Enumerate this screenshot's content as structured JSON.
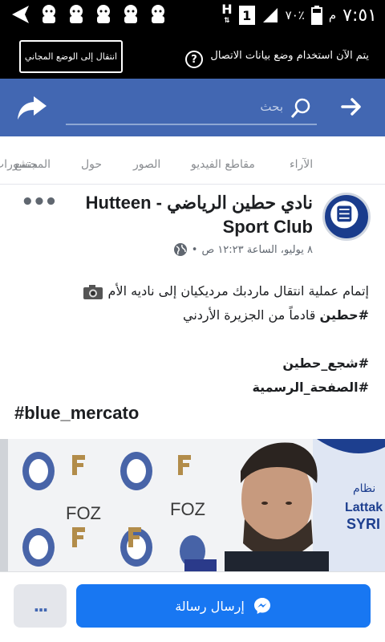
{
  "status_bar": {
    "time": "٧:٥١",
    "am_pm": "م",
    "battery_percent": "٧٠٪",
    "sim_slot": "1",
    "network_type": "H",
    "icons": [
      "back-arrow-icon",
      "notification-icon",
      "signal-icon",
      "battery-icon"
    ]
  },
  "free_mode": {
    "message": "يتم الآن استخدام وضع بيانات الاتصال",
    "switch_button": "انتقال إلى الوضع المجاني",
    "help": "?"
  },
  "search": {
    "placeholder": "بحث"
  },
  "tabs": [
    {
      "label": "منشورات"
    },
    {
      "label": "الآراء"
    },
    {
      "label": "مقاطع الفيديو"
    },
    {
      "label": "الصور"
    },
    {
      "label": "حول"
    },
    {
      "label": "المجتمع"
    }
  ],
  "post": {
    "page_name": "نادي حطين الرياضي - Hutteen Sport Club",
    "date": "٨ يوليو، الساعة ١٢:٢٣ ص",
    "separator": "•",
    "line1": "إتمام عملية انتقال ماردبك مرديكيان إلى ناديه الأم",
    "line2_hash": "#حطين",
    "line2_rest": " قادماً من الجزيرة الأردني",
    "hashtag1": "#شجع_حطين",
    "hashtag2": "#الصفحة_الرسمية",
    "hashtag3": "#blue_mercato",
    "photo_text": [
      "FOZ",
      "FOZ",
      "Lattak",
      "SYRI",
      "نظام"
    ]
  },
  "bottom": {
    "more": "...",
    "send_message": "إرسال رسالة"
  },
  "colors": {
    "facebook_blue": "#4267b2",
    "button_blue": "#1877f2"
  }
}
